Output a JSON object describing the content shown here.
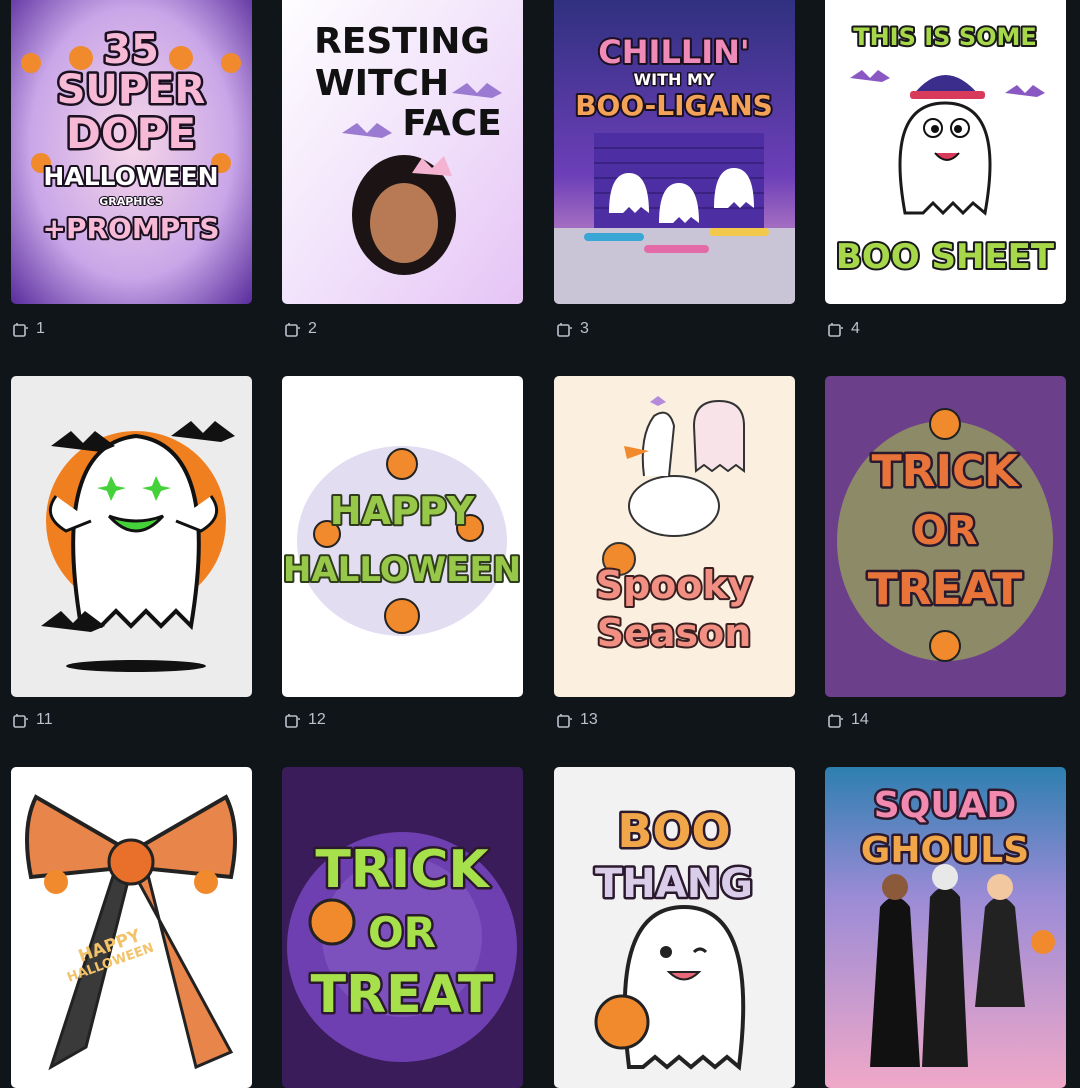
{
  "pages": [
    {
      "page": "1",
      "lines": [
        "35",
        "SUPER",
        "DOPE",
        "HALLOWEEN",
        "GRAPHICS",
        "+PROMPTS"
      ]
    },
    {
      "page": "2",
      "lines": [
        "RESTING",
        "WITCH",
        "FACE"
      ]
    },
    {
      "page": "3",
      "lines": [
        "CHILLIN'",
        "WITH MY",
        "BOO-LIGANS"
      ]
    },
    {
      "page": "4",
      "lines": [
        "THIS IS SOME",
        "BOO SHEET"
      ]
    },
    {
      "page": "11",
      "lines": []
    },
    {
      "page": "12",
      "lines": [
        "HAPPY",
        "HALLOWEEN"
      ]
    },
    {
      "page": "13",
      "lines": [
        "Spooky",
        "Season"
      ]
    },
    {
      "page": "14",
      "lines": [
        "TRICK",
        "OR",
        "TREAT"
      ]
    },
    {
      "page": "",
      "lines": [
        "HAPPY",
        "HALLOWEEN"
      ]
    },
    {
      "page": "",
      "lines": [
        "TRICK",
        "OR",
        "TREAT"
      ]
    },
    {
      "page": "",
      "lines": [
        "BOO",
        "THANG"
      ]
    },
    {
      "page": "",
      "lines": [
        "SQUAD",
        "GHOULS"
      ]
    }
  ],
  "icons": {
    "page_label_icon": "page-icon"
  },
  "colors": {
    "background": "#0f1519",
    "label": "#b9c2cb"
  }
}
